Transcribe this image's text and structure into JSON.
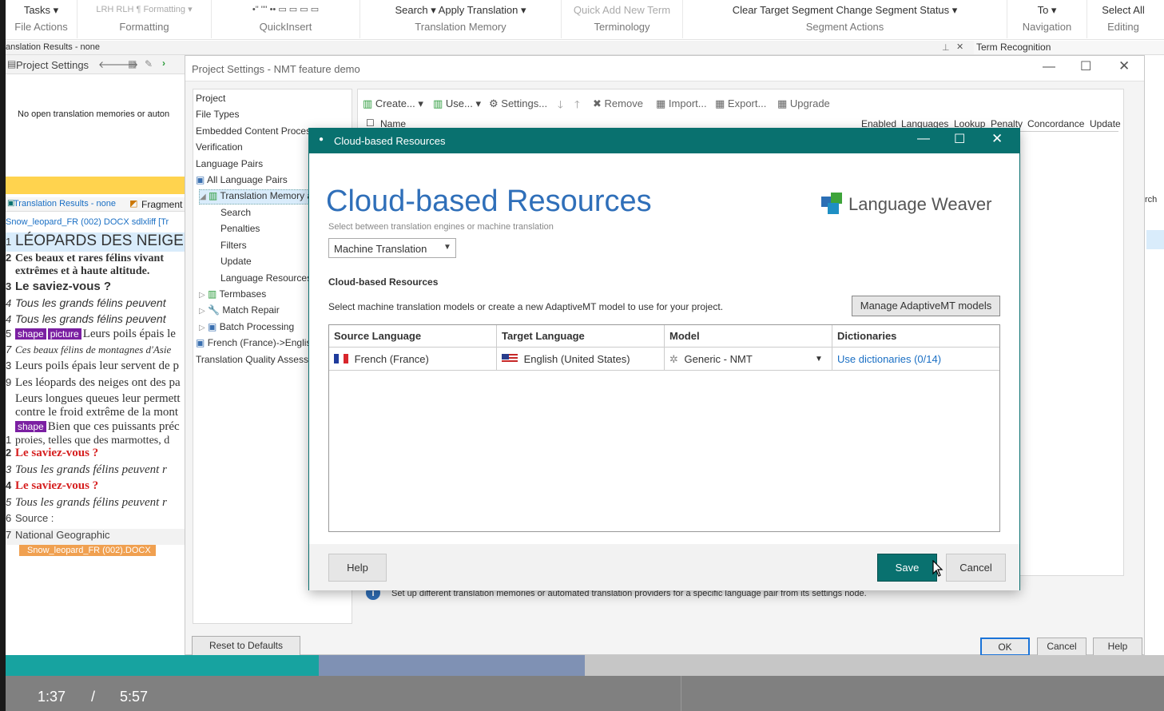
{
  "ribbon": {
    "groups": [
      {
        "top": "Tasks ▾",
        "label": "File Actions"
      },
      {
        "top": "LRH  RLH  ¶  Formatting ▾",
        "label": "Formatting"
      },
      {
        "top": "•\"  \"\"  ••  ▭  ▭  ▭  ▭",
        "label": "QuickInsert"
      },
      {
        "top": "Search ▾    Apply Translation ▾",
        "label": "Translation Memory"
      },
      {
        "top": "Quick Add New Term",
        "label": "Terminology"
      },
      {
        "top": "Clear Target Segment    Change Segment Status ▾",
        "label": "Segment Actions"
      },
      {
        "top": "To ▾",
        "label": "Navigation"
      },
      {
        "top": "Select All",
        "label": "Editing"
      }
    ]
  },
  "panes": {
    "translation_results_top": "anslation Results - none",
    "term_recognition": "Term Recognition",
    "project_settings_tab": "Project Settings",
    "no_open_tm": "No open translation memories or auton",
    "translation_results_tab": "Translation Results - none",
    "fragment_tab": "Fragment",
    "file_path": "Snow_leopard_FR (002) DOCX sdlxliff [Tr"
  },
  "segments": [
    {
      "n": "1",
      "text": "LÉOPARDS DES NEIGE"
    },
    {
      "n": "2",
      "text": "Ces beaux et rares félins vivant"
    },
    {
      "n": "",
      "text": "extrêmes et à haute altitude."
    },
    {
      "n": "3",
      "text": "Le saviez-vous ?"
    },
    {
      "n": "4",
      "text": "Tous les grands félins peuvent"
    },
    {
      "n": "4",
      "text": "Tous les grands félins peuvent"
    },
    {
      "n": "5",
      "tag1": "shape",
      "tag2": "picture",
      "text": "Leurs poils épais le"
    },
    {
      "n": "7",
      "text": "Ces beaux félins de montagnes d'Asie"
    },
    {
      "n": "3",
      "text": "Leurs poils épais leur servent de p"
    },
    {
      "n": "9",
      "text": "Les léopards des neiges ont des pa"
    },
    {
      "n": "",
      "text": "Leurs longues queues leur permett"
    },
    {
      "n": "",
      "text": "contre le froid extrême de la mont"
    },
    {
      "n": "",
      "tag1": "shape",
      "text": "Bien que ces puissants préc"
    },
    {
      "n": "1",
      "text": "proies, telles que des marmottes, d"
    },
    {
      "n": "2",
      "text": "Le saviez-vous ?"
    },
    {
      "n": "3",
      "text": "Tous les grands félins peuvent r"
    },
    {
      "n": "4",
      "text": "Le saviez-vous ?"
    },
    {
      "n": "5",
      "text": "Tous les grands félins peuvent r"
    },
    {
      "n": "6",
      "text": "Source :"
    },
    {
      "n": "7",
      "text": "National Geographic"
    }
  ],
  "file_tag": "Snow_leopard_FR (002).DOCX",
  "project_settings": {
    "title": "Project Settings - NMT feature demo",
    "tree": [
      "Project",
      "File Types",
      "Embedded Content Process",
      "Verification",
      "Language Pairs",
      "All Language Pairs",
      "Translation Memory a",
      "Search",
      "Penalties",
      "Filters",
      "Update",
      "Language Resources",
      "Termbases",
      "Match Repair",
      "Batch Processing",
      "French (France)->Englis",
      "Translation Quality Assessm"
    ],
    "toolbar": [
      "Create...",
      "Use...",
      "Settings...",
      "Remove",
      "Import...",
      "Export...",
      "Upgrade"
    ],
    "grid_headers": [
      "Name",
      "Enabled",
      "Languages",
      "Lookup",
      "Penalty",
      "Concordance",
      "Update"
    ],
    "partial_right": "rch",
    "info": "Set up different translation memories or automated translation providers for a specific language pair from its settings node.",
    "reset": "Reset to Defaults",
    "ok": "OK",
    "cancel": "Cancel",
    "help": "Help"
  },
  "dialog": {
    "title": "Cloud-based Resources",
    "heading": "Cloud-based Resources",
    "brand": "Language Weaver",
    "select_hint": "Select between translation engines or machine translation",
    "dropdown": "Machine Translation",
    "section": "Cloud-based Resources",
    "desc": "Select machine translation models or create a new AdaptiveMT model to use for your project.",
    "manage_btn": "Manage AdaptiveMT models",
    "columns": [
      "Source Language",
      "Target Language",
      "Model",
      "Dictionaries"
    ],
    "row": {
      "source": "French (France)",
      "target": "English (United States)",
      "model": "Generic - NMT",
      "dict": "Use dictionaries (0/14)"
    },
    "help": "Help",
    "save": "Save",
    "cancel": "Cancel"
  },
  "video": {
    "current": "1:37",
    "sep": "/",
    "total": "5:57",
    "progress": 0.27,
    "buffered": 0.5
  },
  "colors": {
    "teal": "#09716f",
    "accent_yellow": "#ffd34e",
    "highlight_blue": "#d9ecfb",
    "red_text": "#d62020",
    "tag_purple": "#7b1fa2",
    "file_orange": "#f0a050"
  }
}
